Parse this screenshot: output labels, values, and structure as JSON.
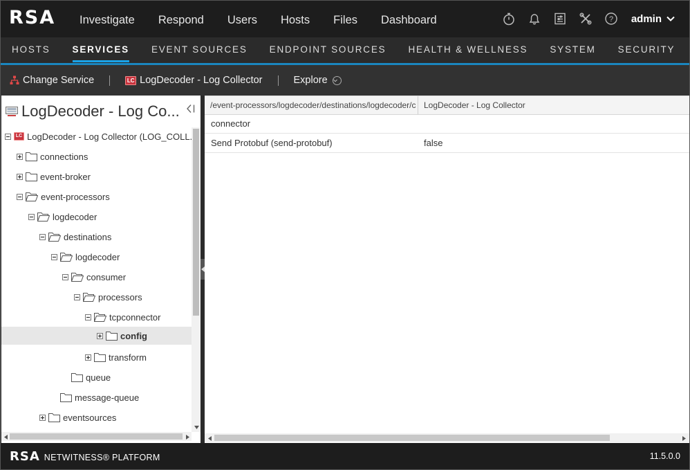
{
  "app": {
    "logo": "RSA",
    "colors": {
      "accent": "#1aa3e8",
      "badge_red": "#c9343e",
      "topbar": "#1d1d1d"
    }
  },
  "topnav": {
    "items": [
      {
        "label": "Investigate"
      },
      {
        "label": "Respond"
      },
      {
        "label": "Users"
      },
      {
        "label": "Hosts"
      },
      {
        "label": "Files"
      },
      {
        "label": "Dashboard"
      }
    ],
    "icons": [
      "stopwatch-icon",
      "bell-icon",
      "preferences-icon",
      "tools-icon",
      "help-icon"
    ],
    "user": "admin"
  },
  "subnav": {
    "items": [
      {
        "label": "HOSTS"
      },
      {
        "label": "SERVICES"
      },
      {
        "label": "EVENT SOURCES"
      },
      {
        "label": "ENDPOINT SOURCES"
      },
      {
        "label": "HEALTH & WELLNESS"
      },
      {
        "label": "SYSTEM"
      },
      {
        "label": "SECURITY"
      }
    ],
    "active": "SERVICES"
  },
  "toolbar": {
    "change_service": "Change Service",
    "service_badge": "LC",
    "service_name": "LogDecoder - Log Collector",
    "explore": "Explore"
  },
  "left_panel": {
    "title": "LogDecoder - Log Co...",
    "tree": [
      {
        "label": "LogDecoder - Log Collector (LOG_COLL...",
        "badge": "LC"
      },
      {
        "label": "connections"
      },
      {
        "label": "event-broker"
      },
      {
        "label": "event-processors"
      },
      {
        "label": "logdecoder"
      },
      {
        "label": "destinations"
      },
      {
        "label": "logdecoder"
      },
      {
        "label": "consumer"
      },
      {
        "label": "processors"
      },
      {
        "label": "tcpconnector"
      },
      {
        "label": "config"
      },
      {
        "label": "transform"
      },
      {
        "label": "queue"
      },
      {
        "label": "message-queue"
      },
      {
        "label": "eventsources"
      }
    ]
  },
  "grid": {
    "headers": [
      "/event-processors/logdecoder/destinations/logdecoder/c",
      "LogDecoder - Log Collector"
    ],
    "rows": [
      [
        "connector",
        ""
      ],
      [
        "Send Protobuf (send-protobuf)",
        "false"
      ]
    ]
  },
  "footer": {
    "logo": "RSA",
    "product": "NETWITNESS® PLATFORM",
    "version": "11.5.0.0"
  }
}
